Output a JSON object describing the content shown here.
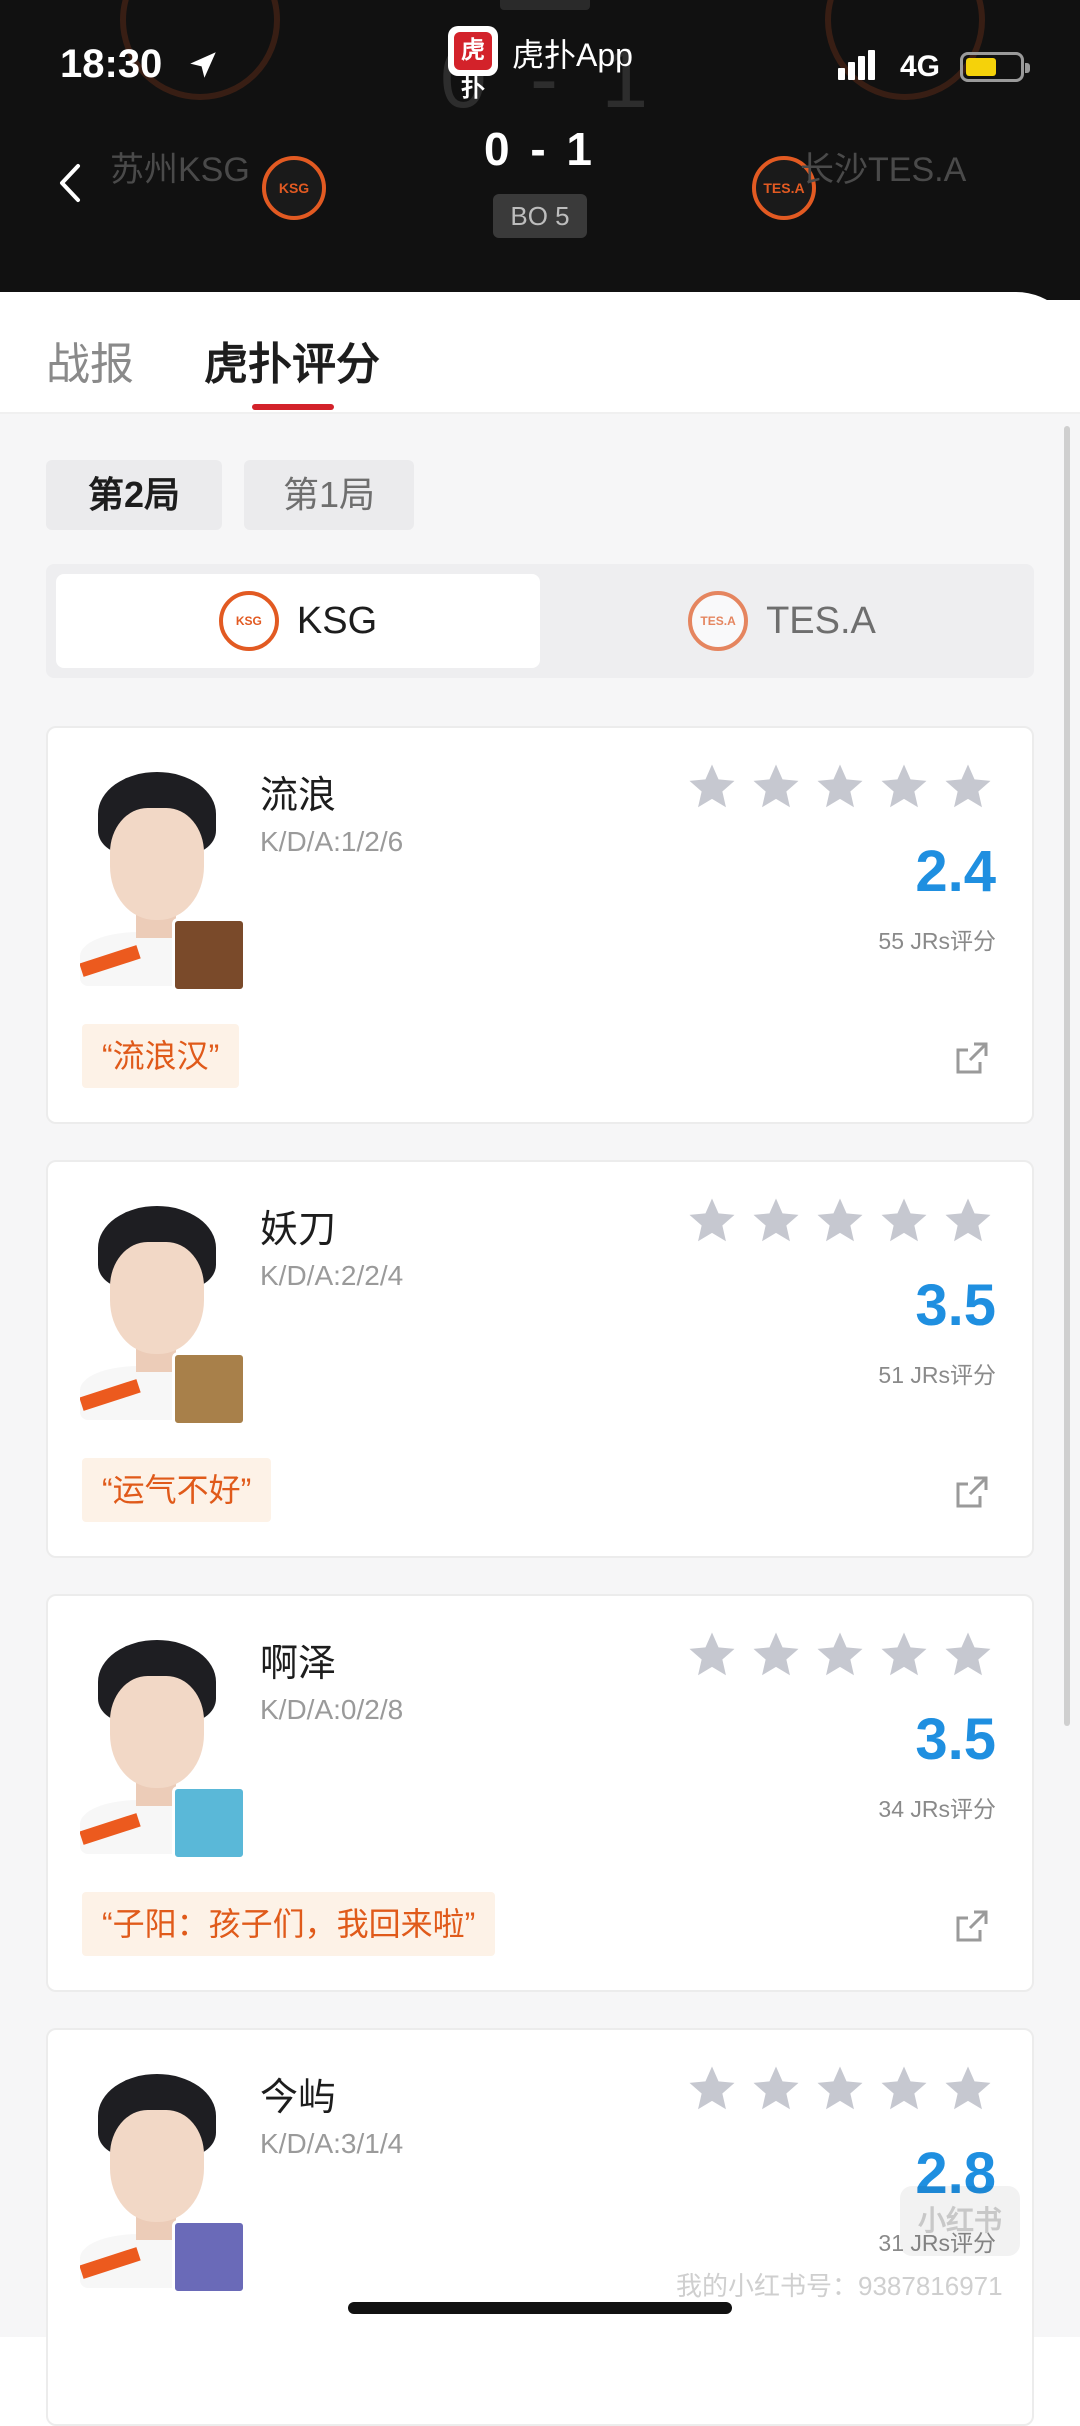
{
  "status_bar": {
    "time": "18:30",
    "network": "4G"
  },
  "app": {
    "badge": "虎扑",
    "name": "虎扑App"
  },
  "match": {
    "home_team": "苏州KSG",
    "away_team": "长沙TES.A",
    "home_logo": "KSG",
    "away_logo": "TES.A",
    "score": "0 - 1",
    "ghost_score": "0 - 1",
    "format": "BO 5"
  },
  "tabs": [
    {
      "label": "战报",
      "active": false
    },
    {
      "label": "虎扑评分",
      "active": true
    }
  ],
  "games": [
    {
      "label": "第2局",
      "active": true
    },
    {
      "label": "第1局",
      "active": false
    }
  ],
  "teams": [
    {
      "name": "KSG",
      "logo": "KSG",
      "active": true
    },
    {
      "name": "TES.A",
      "logo": "TES.A",
      "active": false
    }
  ],
  "players": [
    {
      "name": "流浪",
      "kda": "K/D/A:1/2/6",
      "rating": "2.4",
      "votes": "55 JRs评分",
      "quote": "“流浪汉”",
      "hero_color": "#7a4a2a"
    },
    {
      "name": "妖刀",
      "kda": "K/D/A:2/2/4",
      "rating": "3.5",
      "votes": "51 JRs评分",
      "quote": "“运气不好”",
      "hero_color": "#a8804a"
    },
    {
      "name": "啊泽",
      "kda": "K/D/A:0/2/8",
      "rating": "3.5",
      "votes": "34 JRs评分",
      "quote": "“子阳：孩子们，我回来啦”",
      "hero_color": "#5ab8d8"
    },
    {
      "name": "今屿",
      "kda": "K/D/A:3/1/4",
      "rating": "2.8",
      "votes": "31 JRs评分",
      "quote": "",
      "hero_color": "#6a6ab8"
    }
  ],
  "colors": {
    "accent": "#d3222a",
    "rating_blue": "#1f8fe0",
    "quote_orange": "#e05a1a",
    "star_grey": "#c6c8d0"
  },
  "watermark": {
    "text": "我的小红书号：9387816971",
    "logo": "小红书"
  }
}
